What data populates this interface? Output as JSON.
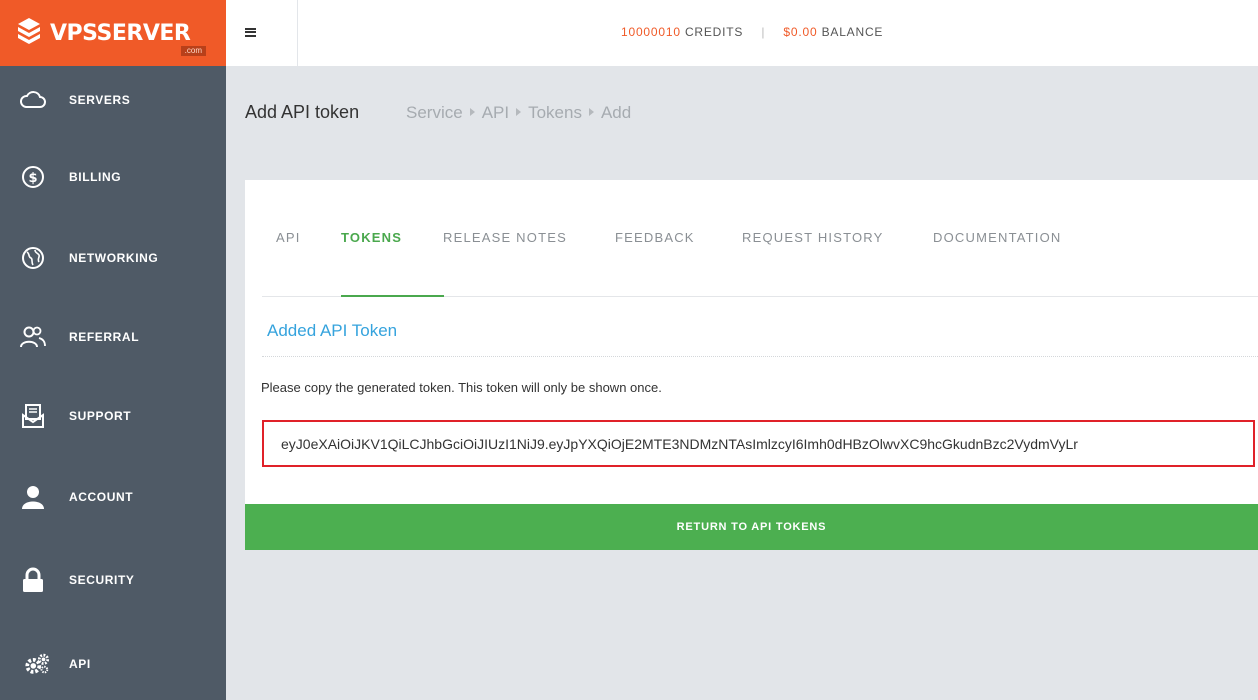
{
  "brand": {
    "name": "VPSSERVER",
    "suffix": ".com",
    "color": "#f05a28"
  },
  "topbar": {
    "credits_value": "10000010",
    "credits_label": "CREDITS",
    "separator": "|",
    "balance_value": "$0.00",
    "balance_label": "BALANCE"
  },
  "sidebar": {
    "items": [
      {
        "label": "SERVERS",
        "icon": "cloud-icon"
      },
      {
        "label": "BILLING",
        "icon": "dollar-circle-icon"
      },
      {
        "label": "NETWORKING",
        "icon": "globe-icon"
      },
      {
        "label": "REFERRAL",
        "icon": "users-icon"
      },
      {
        "label": "SUPPORT",
        "icon": "envelope-document-icon"
      },
      {
        "label": "ACCOUNT",
        "icon": "user-icon"
      },
      {
        "label": "SECURITY",
        "icon": "lock-icon"
      },
      {
        "label": "API",
        "icon": "gears-icon"
      }
    ]
  },
  "header": {
    "title": "Add API token",
    "breadcrumb": [
      "Service",
      "API",
      "Tokens",
      "Add"
    ]
  },
  "tabs": [
    {
      "label": "API",
      "active": false
    },
    {
      "label": "TOKENS",
      "active": true
    },
    {
      "label": "RELEASE NOTES",
      "active": false
    },
    {
      "label": "FEEDBACK",
      "active": false
    },
    {
      "label": "REQUEST HISTORY",
      "active": false
    },
    {
      "label": "DOCUMENTATION",
      "active": false
    }
  ],
  "content": {
    "section_title": "Added API Token",
    "instructions": "Please copy the generated token. This token will only be shown once.",
    "token": "eyJ0eXAiOiJKV1QiLCJhbGciOiJIUzI1NiJ9.eyJpYXQiOjE2MTE3NDMzNTAsImlzcyI6Imh0dHBzOlwvXC9hcGkudnBzc2VydmVyLr",
    "return_button": "RETURN TO API TOKENS"
  },
  "colors": {
    "sidebar_bg": "#4f5a66",
    "active_tab": "#4aa84d",
    "section_title": "#35a3dd",
    "highlight_border": "#e02129",
    "button_bg": "#4caf50"
  }
}
